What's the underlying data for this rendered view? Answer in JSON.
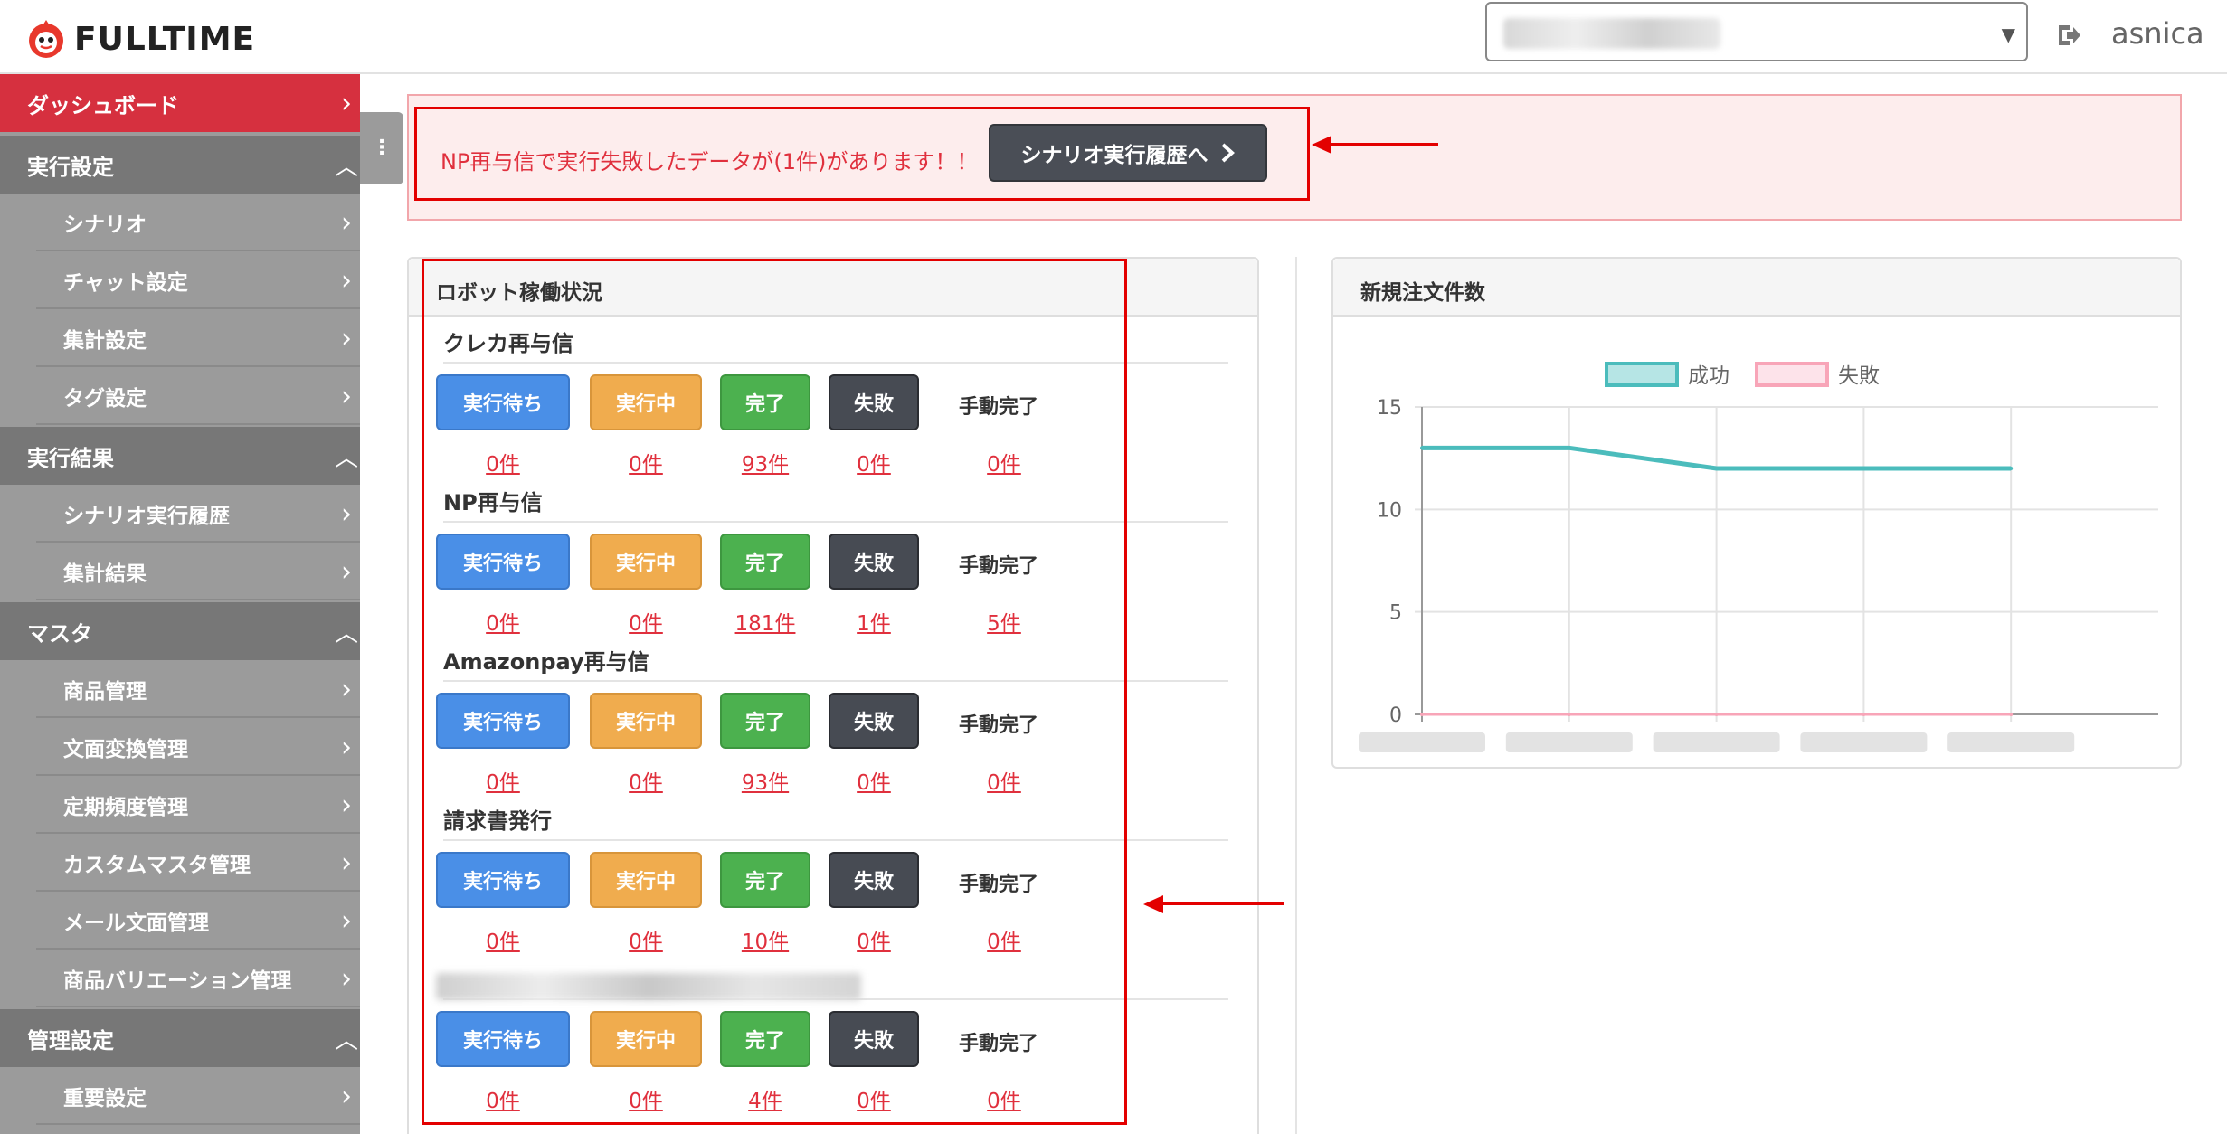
{
  "header": {
    "logo_text": "FULLTIME",
    "user_name": "asnica"
  },
  "sidebar": {
    "dashboard": "ダッシュボード",
    "sections": [
      {
        "label": "実行設定",
        "items": [
          "シナリオ",
          "チャット設定",
          "集計設定",
          "タグ設定"
        ]
      },
      {
        "label": "実行結果",
        "items": [
          "シナリオ実行履歴",
          "集計結果"
        ]
      },
      {
        "label": "マスタ",
        "items": [
          "商品管理",
          "文面変換管理",
          "定期頻度管理",
          "カスタムマスタ管理",
          "メール文面管理",
          "商品バリエーション管理"
        ]
      },
      {
        "label": "管理設定",
        "items": [
          "重要設定"
        ]
      }
    ]
  },
  "alert": {
    "message": "NP再与信で実行失敗したデータが(1件)があります！！",
    "button_label": "シナリオ実行履歴へ"
  },
  "robot_panel": {
    "title": "ロボット稼働状況",
    "status_labels": {
      "wait": "実行待ち",
      "running": "実行中",
      "done": "完了",
      "failed": "失敗",
      "manual": "手動完了"
    },
    "sections": [
      {
        "title": "クレカ再与信",
        "counts": [
          "0件",
          "0件",
          "93件",
          "0件",
          "0件"
        ]
      },
      {
        "title": "NP再与信",
        "counts": [
          "0件",
          "0件",
          "181件",
          "1件",
          "5件"
        ]
      },
      {
        "title": "Amazonpay再与信",
        "counts": [
          "0件",
          "0件",
          "93件",
          "0件",
          "0件"
        ]
      },
      {
        "title": "請求書発行",
        "counts": [
          "0件",
          "0件",
          "10件",
          "0件",
          "0件"
        ]
      },
      {
        "title": "",
        "counts": [
          "0件",
          "0件",
          "4件",
          "0件",
          "0件"
        ]
      }
    ]
  },
  "chart_panel": {
    "title": "新規注文件数"
  },
  "chart_data": {
    "type": "line",
    "title": "",
    "xlabel": "",
    "ylabel": "",
    "ylim": [
      0,
      15
    ],
    "yticks": [
      0,
      5,
      10,
      15
    ],
    "legend_position": "top",
    "grid": true,
    "series": [
      {
        "name": "成功",
        "values": [
          13,
          13,
          12,
          12,
          12
        ],
        "color": "#4bbcbc"
      },
      {
        "name": "失敗",
        "values": [
          0,
          0,
          0,
          0,
          0
        ],
        "color": "#f8a5b8"
      }
    ]
  }
}
